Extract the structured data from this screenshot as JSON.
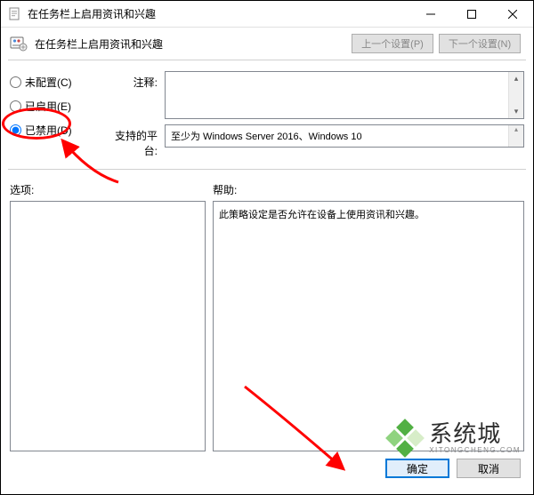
{
  "titlebar": {
    "title": "在任务栏上启用资讯和兴趣"
  },
  "subheader": {
    "title": "在任务栏上启用资讯和兴趣",
    "prev_btn": "上一个设置(P)",
    "next_btn": "下一个设置(N)"
  },
  "radio": {
    "not_configured": "未配置(C)",
    "enabled": "已启用(E)",
    "disabled": "已禁用(D)"
  },
  "labels": {
    "comment": "注释:",
    "platform": "支持的平台:",
    "options": "选项:",
    "help": "帮助:"
  },
  "platform_text": "至少为 Windows Server 2016、Windows 10",
  "help_text": "此策略设定是否允许在设备上使用资讯和兴趣。",
  "buttons": {
    "ok": "确定",
    "cancel": "取消"
  },
  "watermark": {
    "main": "系统城",
    "sub": "XITONGCHENG.COM"
  }
}
